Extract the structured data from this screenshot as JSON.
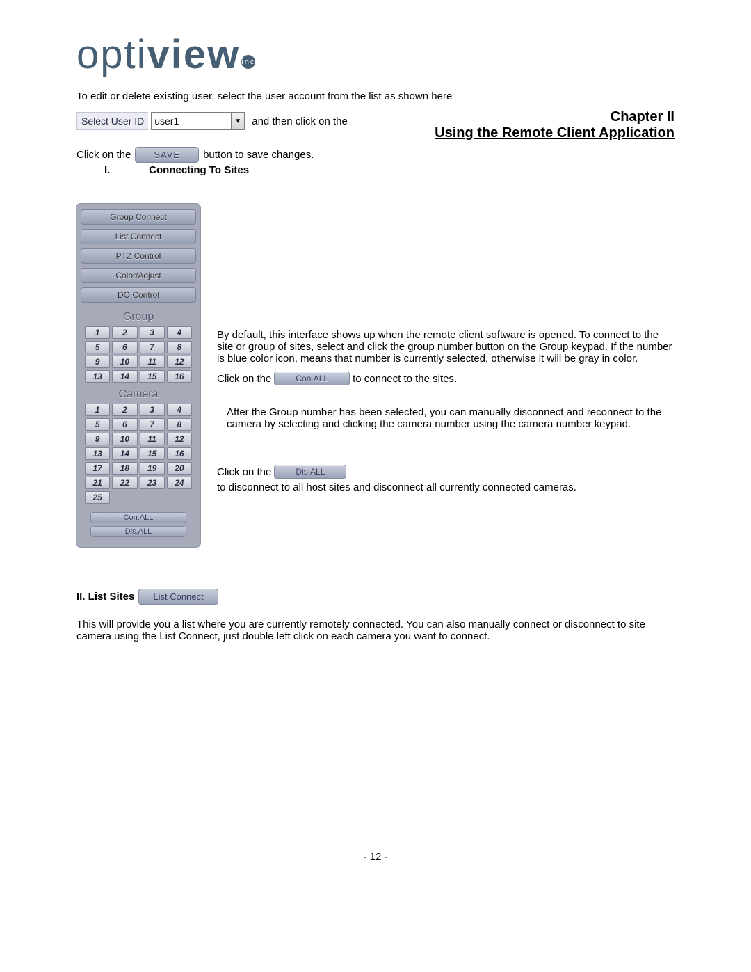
{
  "logo": {
    "part1": "opti",
    "part2": "view",
    "inc": "inc"
  },
  "intro": "To edit or delete existing user, select the user account from the list as shown here",
  "selectUser": {
    "label": "Select User ID",
    "value": "user1"
  },
  "afterSelect": "and then click on the",
  "chapter": {
    "title": "Chapter II",
    "subtitle": "Using the Remote Client Application"
  },
  "saveRow": {
    "pre": "Click on the",
    "btn": "SAVE",
    "post": "button to save changes."
  },
  "section1": {
    "num": "I.",
    "title": "Connecting To Sites"
  },
  "panel": {
    "tabs": [
      "Group Connect",
      "List Connect",
      "PTZ Control",
      "Color/Adjust",
      "DO Control"
    ],
    "groupLabel": "Group",
    "groupKeys": [
      "1",
      "2",
      "3",
      "4",
      "5",
      "6",
      "7",
      "8",
      "9",
      "10",
      "11",
      "12",
      "13",
      "14",
      "15",
      "16"
    ],
    "cameraLabel": "Camera",
    "cameraKeys": [
      "1",
      "2",
      "3",
      "4",
      "5",
      "6",
      "7",
      "8",
      "9",
      "10",
      "11",
      "12",
      "13",
      "14",
      "15",
      "16",
      "17",
      "18",
      "19",
      "20",
      "21",
      "22",
      "23",
      "24",
      "25"
    ],
    "footer": {
      "con": "Con.ALL",
      "dis": "Dis.ALL"
    }
  },
  "para1": "By default, this interface shows up when the remote client software is opened. To connect to the site or group of sites, select and click the group number button on the Group keypad.  If the number is blue color icon, means that number is currently selected, otherwise it will be gray in color.",
  "conRow": {
    "pre": "Click on the",
    "btn": "Con.ALL",
    "post": "to connect to the sites."
  },
  "para2": "After the Group number has been selected, you can manually disconnect and reconnect to the camera by selecting and clicking the camera number using the camera number keypad.",
  "disRow": {
    "pre": "Click on the",
    "btn": "Dis.ALL",
    "post": "to disconnect to all host sites and disconnect all currently connected cameras."
  },
  "section2": {
    "label": "II. List Sites",
    "btn": "List Connect"
  },
  "finalPara": "This will provide you a list where you are currently remotely connected. You can also manually connect or disconnect to site camera using the List Connect, just double left click on each camera you want to connect.",
  "pageNum": "- 12 -"
}
